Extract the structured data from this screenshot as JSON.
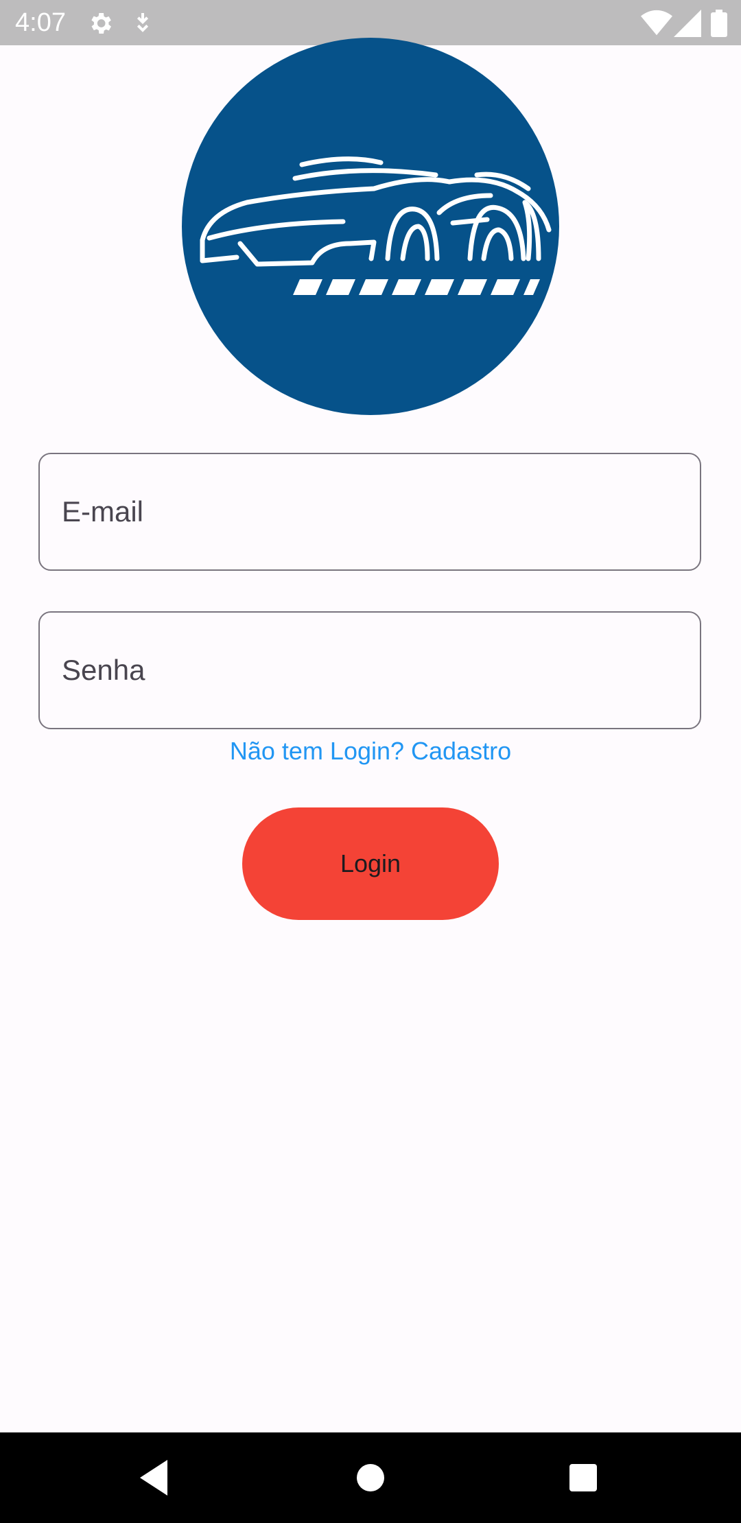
{
  "status_bar": {
    "time": "4:07",
    "icons": [
      "settings-icon",
      "download-icon",
      "wifi-icon",
      "signal-icon",
      "battery-icon"
    ]
  },
  "logo": {
    "icon": "car-logo",
    "background_color": "#06528a"
  },
  "form": {
    "email_label": "E-mail",
    "password_label": "Senha",
    "signup_link": "Não tem Login? Cadastro",
    "login_button": "Login"
  },
  "nav_bar": {
    "icons": [
      "back-icon",
      "home-icon",
      "recents-icon"
    ]
  },
  "colors": {
    "accent_button": "#f44336",
    "link": "#2196f3",
    "background": "#fefbfe"
  }
}
